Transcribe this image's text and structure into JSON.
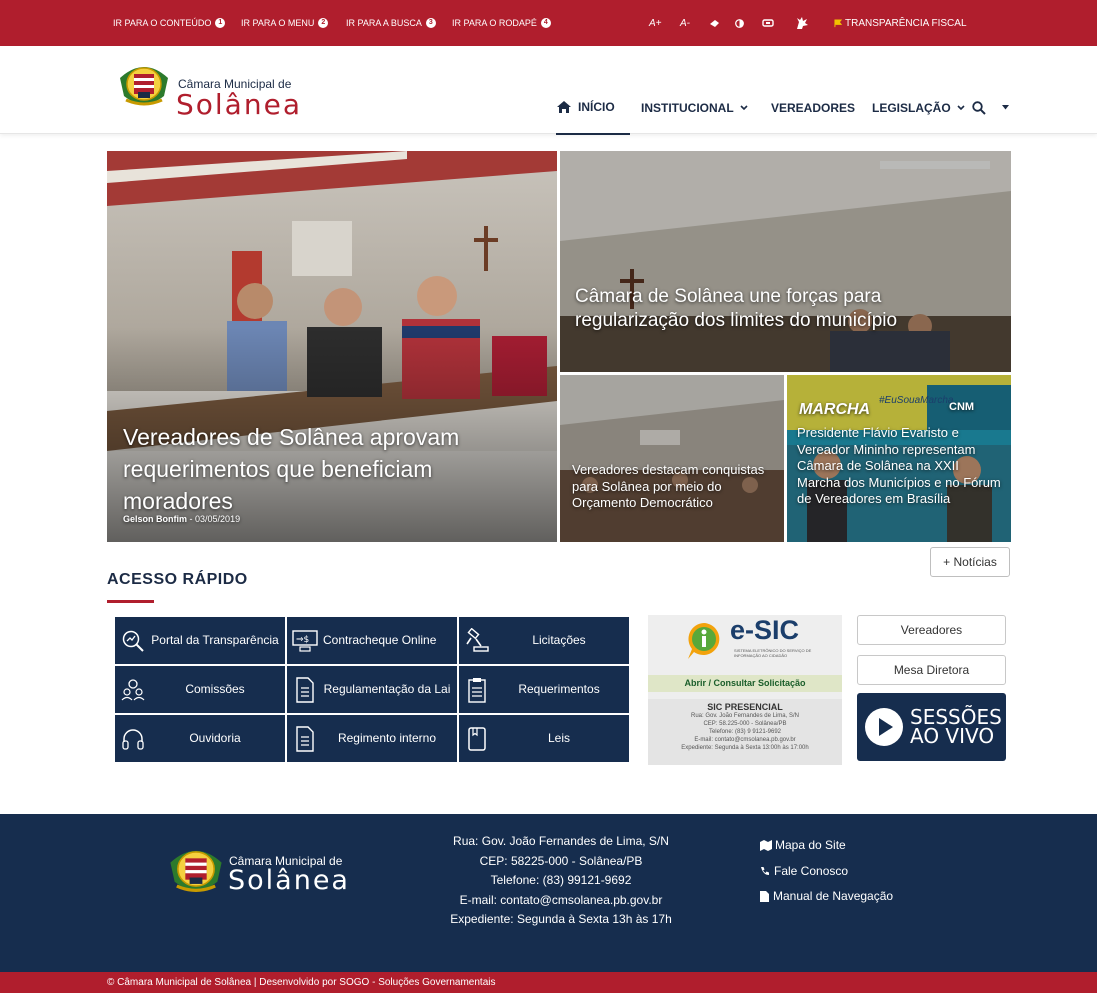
{
  "topbar": {
    "skip_links": [
      {
        "label": "IR PARA O CONTEÚDO",
        "num": "1"
      },
      {
        "label": "IR PARA O MENU",
        "num": "2"
      },
      {
        "label": "IR PARA A BUSCA",
        "num": "3"
      },
      {
        "label": "IR PARA O RODAPÉ",
        "num": "4"
      }
    ],
    "font_increase": "A+",
    "font_decrease": "A-",
    "transparency_fiscal": "TRANSPARÊNCIA FISCAL"
  },
  "header": {
    "logo_small": "Câmara Municipal de",
    "logo_big": "Solânea",
    "nav": {
      "home": "INÍCIO",
      "institucional": "INSTITUCIONAL",
      "vereadores": "VEREADORES",
      "legislacao": "LEGISLAÇÃO"
    }
  },
  "news": {
    "main": {
      "title": "Vereadores de Solânea aprovam requerimentos que beneficiam moradores",
      "author": "Gelson Bonfim",
      "date": "03/05/2019"
    },
    "top_right": {
      "title": "Câmara de Solânea une forças para regularização dos limites do município"
    },
    "bottom_left": {
      "title": "Vereadores destacam conquistas para Solânea por meio do Orçamento Democrático"
    },
    "bottom_right": {
      "title": "Presidente Flávio Evaristo e Vereador Mininho representam Câmara de Solânea na XXII Marcha dos Municípios e no Fórum de Vereadores em Brasília",
      "banner_text": "MARCHA",
      "banner_tag": "#EuSouaMarcha",
      "banner_cnm": "CNM"
    },
    "more_button": "+ Notícias"
  },
  "quick_access": {
    "title": "ACESSO RÁPIDO",
    "tiles": [
      {
        "label": "Portal da Transparência",
        "icon": "magnifier-chart-icon"
      },
      {
        "label": "Contracheque Online",
        "icon": "paycheck-icon"
      },
      {
        "label": "Licitações",
        "icon": "gavel-icon"
      },
      {
        "label": "Comissões",
        "icon": "group-icon"
      },
      {
        "label": "Regulamentação da Lai",
        "icon": "document-icon"
      },
      {
        "label": "Requerimentos",
        "icon": "clipboard-icon"
      },
      {
        "label": "Ouvidoria",
        "icon": "headset-icon"
      },
      {
        "label": "Regimento interno",
        "icon": "document-icon"
      },
      {
        "label": "Leis",
        "icon": "book-icon"
      }
    ],
    "esic": {
      "logo_text": "e-SIC",
      "logo_sub": "SISTEMA ELETRÔNICO DO SERVIÇO DE INFORMAÇÃO AO CIDADÃO",
      "link": "Abrir / Consultar Solicitação",
      "presencial_title": "SIC PRESENCIAL",
      "presencial_lines": [
        "Rua: Gov. João Fernandes de Lima, S/N",
        "CEP: 58.225-000 - Solânea/PB",
        "Telefone: (83) 9 9121-9692",
        "E-mail: contato@cmsolanea.pb.gov.br",
        "Expediente: Segunda à Sexta 13:00h às 17:00h"
      ]
    },
    "vereadores_button": "Vereadores",
    "mesa_button": "Mesa Diretora",
    "sessoes_line1": "SESSÕES",
    "sessoes_line2": "AO VIVO"
  },
  "footer": {
    "logo_small": "Câmara Municipal de",
    "logo_big": "Solânea",
    "address_lines": [
      "Rua: Gov. João Fernandes de Lima, S/N",
      "CEP: 58225-000 - Solânea/PB",
      "Telefone: (83) 99121-9692",
      "E-mail: contato@cmsolanea.pb.gov.br",
      "Expediente: Segunda à Sexta 13h às 17h"
    ],
    "links": {
      "sitemap": "Mapa do Site",
      "contact": "Fale Conosco",
      "manual": "Manual de Navegação"
    },
    "copyright": "© Câmara Municipal de Solânea | Desenvolvido por SOGO - Soluções Governamentais"
  },
  "colors": {
    "brand_red": "#b01e2d",
    "navy": "#162d4e",
    "header_text": "#1c2b45"
  }
}
